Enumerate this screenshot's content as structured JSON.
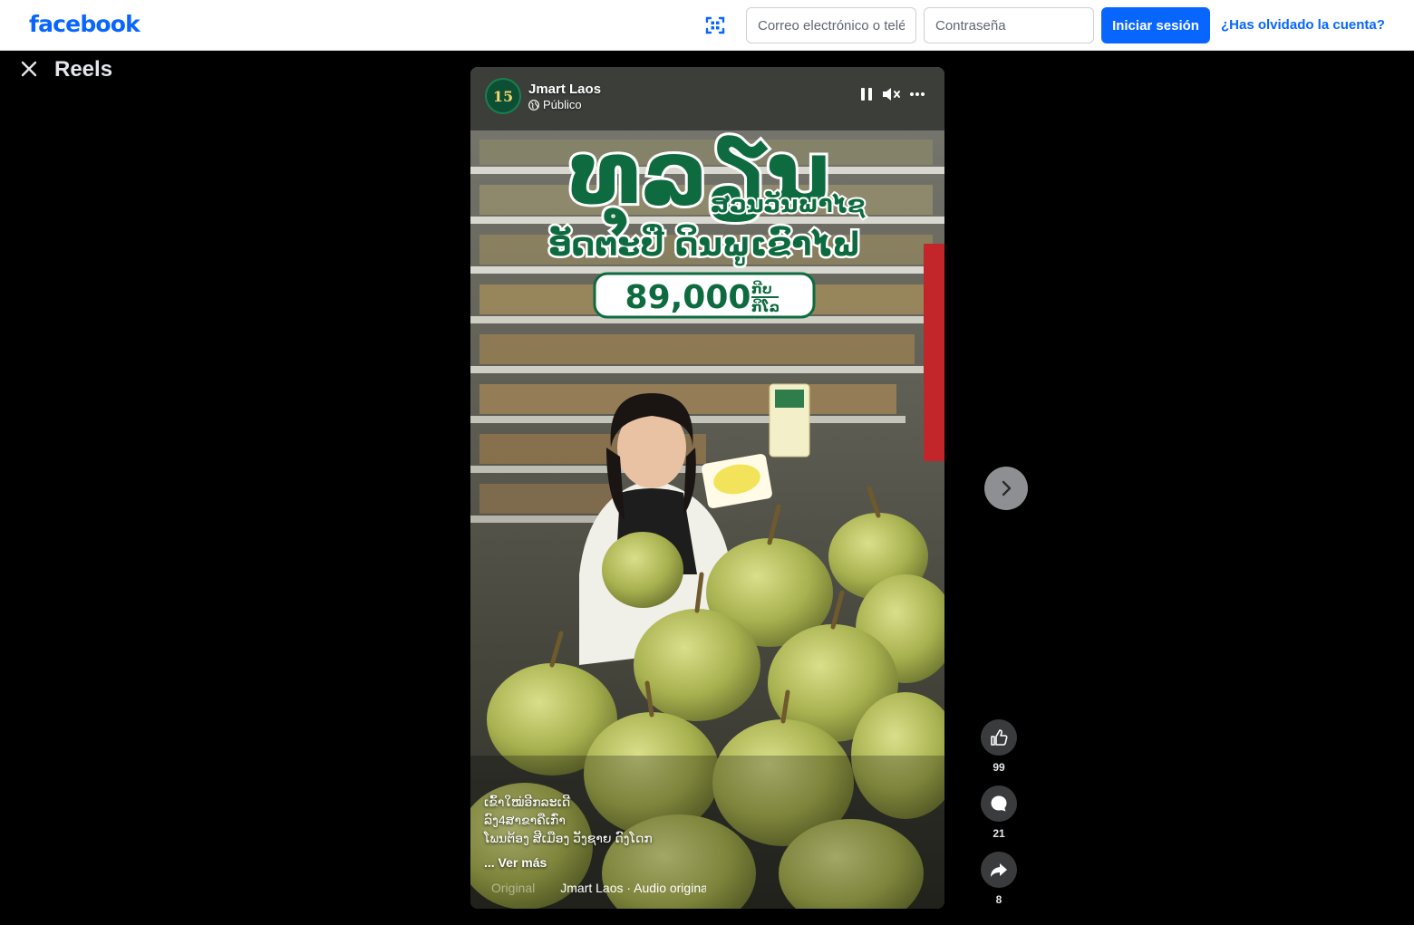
{
  "header": {
    "logo": "facebook",
    "email_placeholder": "Correo electrónico o teléfono",
    "password_placeholder": "Contraseña",
    "login_label": "Iniciar sesión",
    "forgot_label": "¿Has olvidado la cuenta?"
  },
  "page": {
    "title": "Reels"
  },
  "reel": {
    "page_name": "Jmart Laos",
    "privacy": "Público",
    "avatar_text": "15",
    "overlay": {
      "headline": "ທຸລຽນ",
      "subheadline": "ສວນວັນພາໄຊ",
      "tagline": "ອັດຕະປື ດິນພູເຂົາໄຟ",
      "price": "89,000",
      "price_unit_top": "ກີບ",
      "price_unit_bottom": "ກິໂລ"
    },
    "caption_lines": [
      "ເຂົ້າໃໝ່ອີກລະເດີ",
      "ລົງ4ສາຂາຄືເກົ່າ",
      "ໂພນຕ້ອງ ສີເມືອງ ວັງຊາຍ ດົງໂດກ"
    ],
    "see_more": "... Ver más",
    "audio_prefix": "Original",
    "audio_label": "Jmart Laos · Audio original"
  },
  "actions": {
    "likes": "99",
    "comments": "21",
    "shares": "8"
  },
  "colors": {
    "brand": "#0866ff",
    "overlay_green": "#0e6b3f"
  }
}
